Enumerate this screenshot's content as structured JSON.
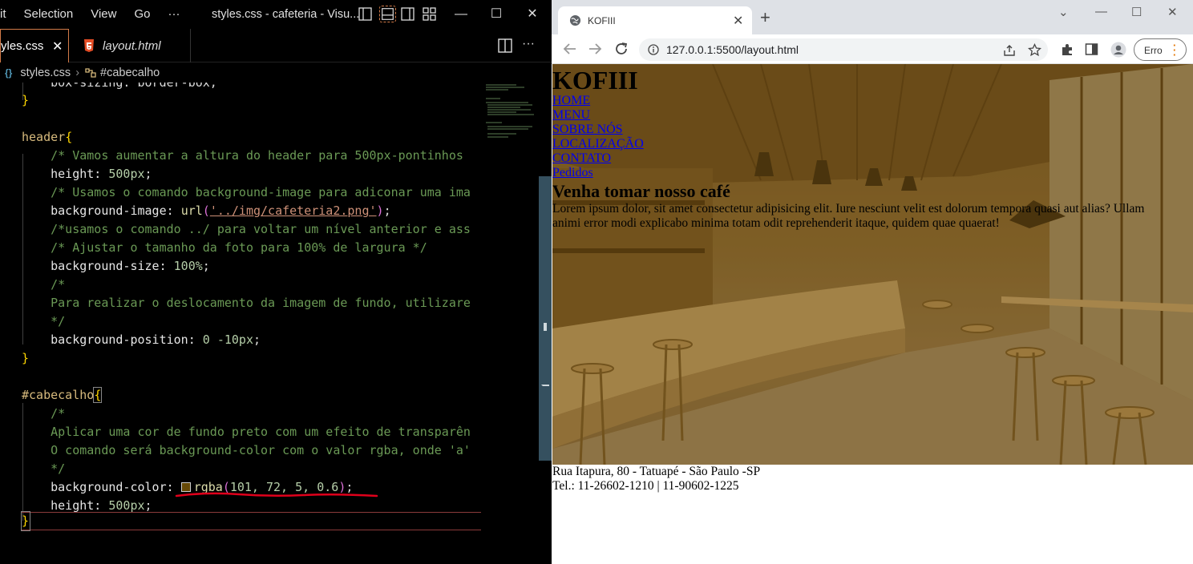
{
  "vscode": {
    "menu": [
      "it",
      "Selection",
      "View",
      "Go",
      "···"
    ],
    "window_title": "styles.css - cafeteria - Visu...",
    "tabs": [
      {
        "label": "yles.css",
        "close": "✕"
      },
      {
        "label": "layout.html"
      }
    ],
    "breadcrumb": {
      "file": "styles.css",
      "symbol": "#cabecalho"
    },
    "code": {
      "l0": "    box-sizing: border-box;",
      "l2_sel": "header",
      "l3": "    /* Vamos aumentar a altura do header para 500px-pontinhos",
      "l4_prop": "    height: ",
      "l4_val": "500px",
      "l5": "    /* Usamos o comando background-image para adiconar uma ima",
      "l6_prop": "    background-image: ",
      "l6_fn": "url",
      "l6_str": "'../img/cafeteria2.png'",
      "l7": "    /*usamos o comando ../ para voltar um nível anterior e ass",
      "l8": "    /* Ajustar o tamanho da foto para 100% de largura */",
      "l9_prop": "    background-size: ",
      "l9_val": "100%",
      "l10": "    /*",
      "l11": "    Para realizar o deslocamento da imagem de fundo, utilizare",
      "l12": "    */",
      "l13_prop": "    background-position: ",
      "l13_val": "0 -10px",
      "l15_sel": "#cabecalho",
      "l16": "    /*",
      "l17": "    Aplicar uma cor de fundo preto com um efeito de transparên",
      "l18": "    O comando será background-color com o valor rgba, onde 'a'",
      "l19": "    */",
      "l20_prop": "    background-color: ",
      "l20_fn": "rgba",
      "l20_args": "101, 72, 5, 0.6",
      "l21_prop": "    height: ",
      "l21_val": "500px"
    }
  },
  "browser": {
    "tab_title": "KOFIII",
    "url": "127.0.0.1:5500/layout.html",
    "error_button": "Erro",
    "page": {
      "title": "KOFIII",
      "nav": [
        "HOME",
        "MENU",
        "SOBRE NÓS",
        "LOCALIZAÇÃO",
        "CONTATO",
        "Pedidos"
      ],
      "headline": "Venha tomar nosso café",
      "paragraph": "Lorem ipsum dolor, sit amet consectetur adipisicing elit. Iure nesciunt velit est dolorum tempora quasi aut alias? Ullam animi error modi explicabo minima totam odit reprehenderit itaque, quidem quae quaerat!",
      "address": "Rua Itapura, 80 - Tatuapé - São Paulo -SP",
      "phones": "Tel.: 11-26602-1210 | 11-90602-1225"
    }
  },
  "colors": {
    "overlay": "rgba(101, 72, 5, 0.6)",
    "editor_tab_border": "#d37b48",
    "annotation_underline": "#e0001b"
  }
}
